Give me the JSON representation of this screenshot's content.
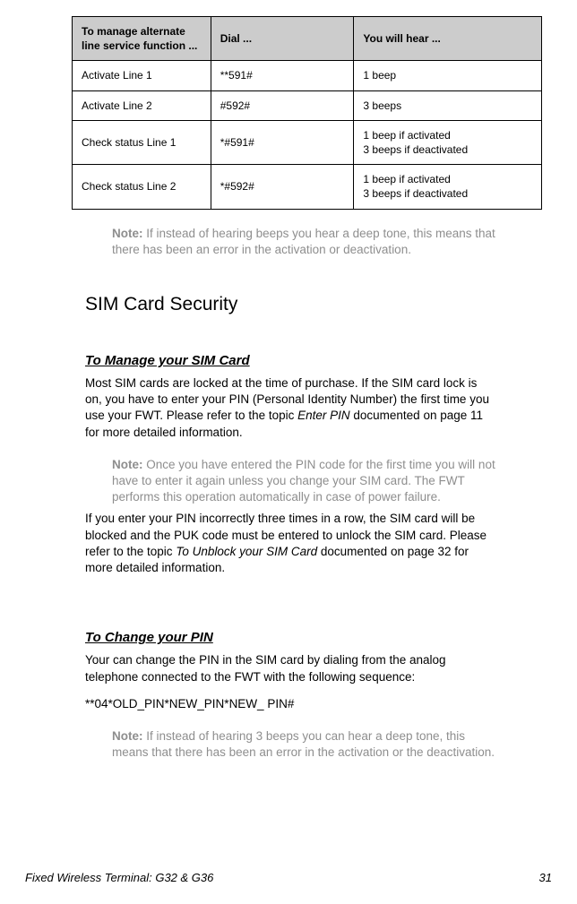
{
  "table": {
    "headers": {
      "func": "To manage alternate line service function ...",
      "dial": "Dial ...",
      "hear": "You will hear ..."
    },
    "rows": [
      {
        "func": "Activate Line 1",
        "dial": "**591#",
        "hear": "1 beep"
      },
      {
        "func": "Activate Line 2",
        "dial": "#592#",
        "hear": "3 beeps"
      },
      {
        "func": "Check status Line 1",
        "dial": "*#591#",
        "hear": "1 beep if activated\n3 beeps if deactivated"
      },
      {
        "func": "Check status Line 2",
        "dial": "*#592#",
        "hear": "1 beep if activated\n3 beeps if deactivated"
      }
    ]
  },
  "note1": {
    "label": "Note:",
    "text": " If instead of hearing beeps you hear a deep tone, this means that there has been an error in the activation or deactivation."
  },
  "heading_sim": "SIM Card Security",
  "heading_manage": "To Manage your SIM Card",
  "para_manage_1a": "Most SIM cards are locked at the time of purchase. If the SIM card lock is on, you have to enter your PIN (Personal Identity Number) the first time you use your FWT. Please refer to the topic ",
  "para_manage_1b": "Enter PIN",
  "para_manage_1c": " documented on page 11 for more detailed information.",
  "note2": {
    "label": "Note:",
    "text": " Once you have entered the PIN code for the first time you will not have to enter it again unless you change your SIM card. The FWT performs this operation automatically in case of power failure."
  },
  "para_manage_2a": "If you enter your PIN incorrectly three times in a row, the SIM card will be blocked and the PUK code must be entered to unlock the SIM card. Please refer to the topic ",
  "para_manage_2b": "To Unblock your SIM Card",
  "para_manage_2c": " documented on page 32 for more detailed information.",
  "heading_change_pin": "To Change your PIN",
  "para_change_1": "Your can change the PIN in the SIM card by dialing from the analog telephone connected to the FWT with the following sequence:",
  "code_line": "**04*OLD_PIN*NEW_PIN*NEW_ PIN#",
  "note3": {
    "label": "Note:",
    "text": " If instead of hearing 3 beeps you can hear a deep tone, this means that there has been an error in the activation or the deactivation."
  },
  "footer": {
    "title": "Fixed Wireless Terminal: G32 & G36",
    "page": "31"
  }
}
